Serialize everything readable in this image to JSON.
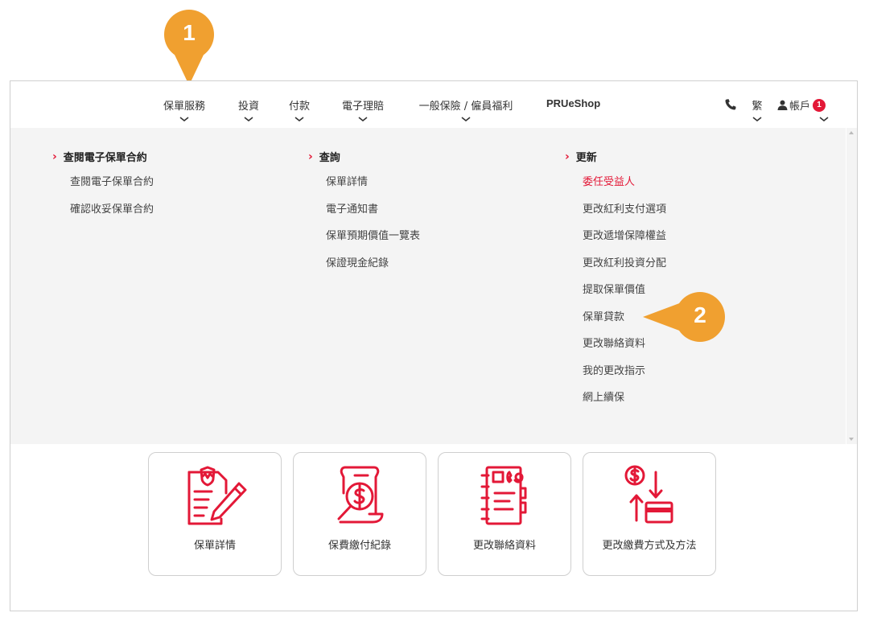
{
  "nav": {
    "items": [
      {
        "label": "保單服務"
      },
      {
        "label": "投資"
      },
      {
        "label": "付款"
      },
      {
        "label": "電子理賠"
      },
      {
        "label": "一般保險 / 僱員福利"
      }
    ],
    "shop_label": "PRUeShop",
    "language_label": "繁",
    "account_label": "帳戶",
    "account_badge": "1"
  },
  "menu": {
    "columns": [
      {
        "heading": "查閱電子保單合約",
        "items": [
          "查閱電子保單合約",
          "確認收妥保單合約"
        ]
      },
      {
        "heading": "查詢",
        "items": [
          "保單詳情",
          "電子通知書",
          "保單預期價值一覽表",
          "保證現金紀錄"
        ]
      },
      {
        "heading": "更新",
        "items": [
          "委任受益人",
          "更改紅利支付選項",
          "更改遞增保障權益",
          "更改紅利投資分配",
          "提取保單價值",
          "保單貸款",
          "更改聯絡資料",
          "我的更改指示",
          "網上續保"
        ]
      }
    ],
    "active_item": "委任受益人"
  },
  "cards": [
    {
      "label": "保單詳情",
      "icon": "policy-document-pen-icon"
    },
    {
      "label": "保費繳付紀錄",
      "icon": "payment-record-magnifier-icon"
    },
    {
      "label": "更改聯絡資料",
      "icon": "contact-notebook-icon"
    },
    {
      "label": "更改繳費方式及方法",
      "icon": "payment-method-card-icon"
    }
  ],
  "callouts": [
    "1",
    "2"
  ],
  "colors": {
    "accent": "#e31837",
    "callout": "#f0a030",
    "menu_bg": "#f4f4f4"
  }
}
